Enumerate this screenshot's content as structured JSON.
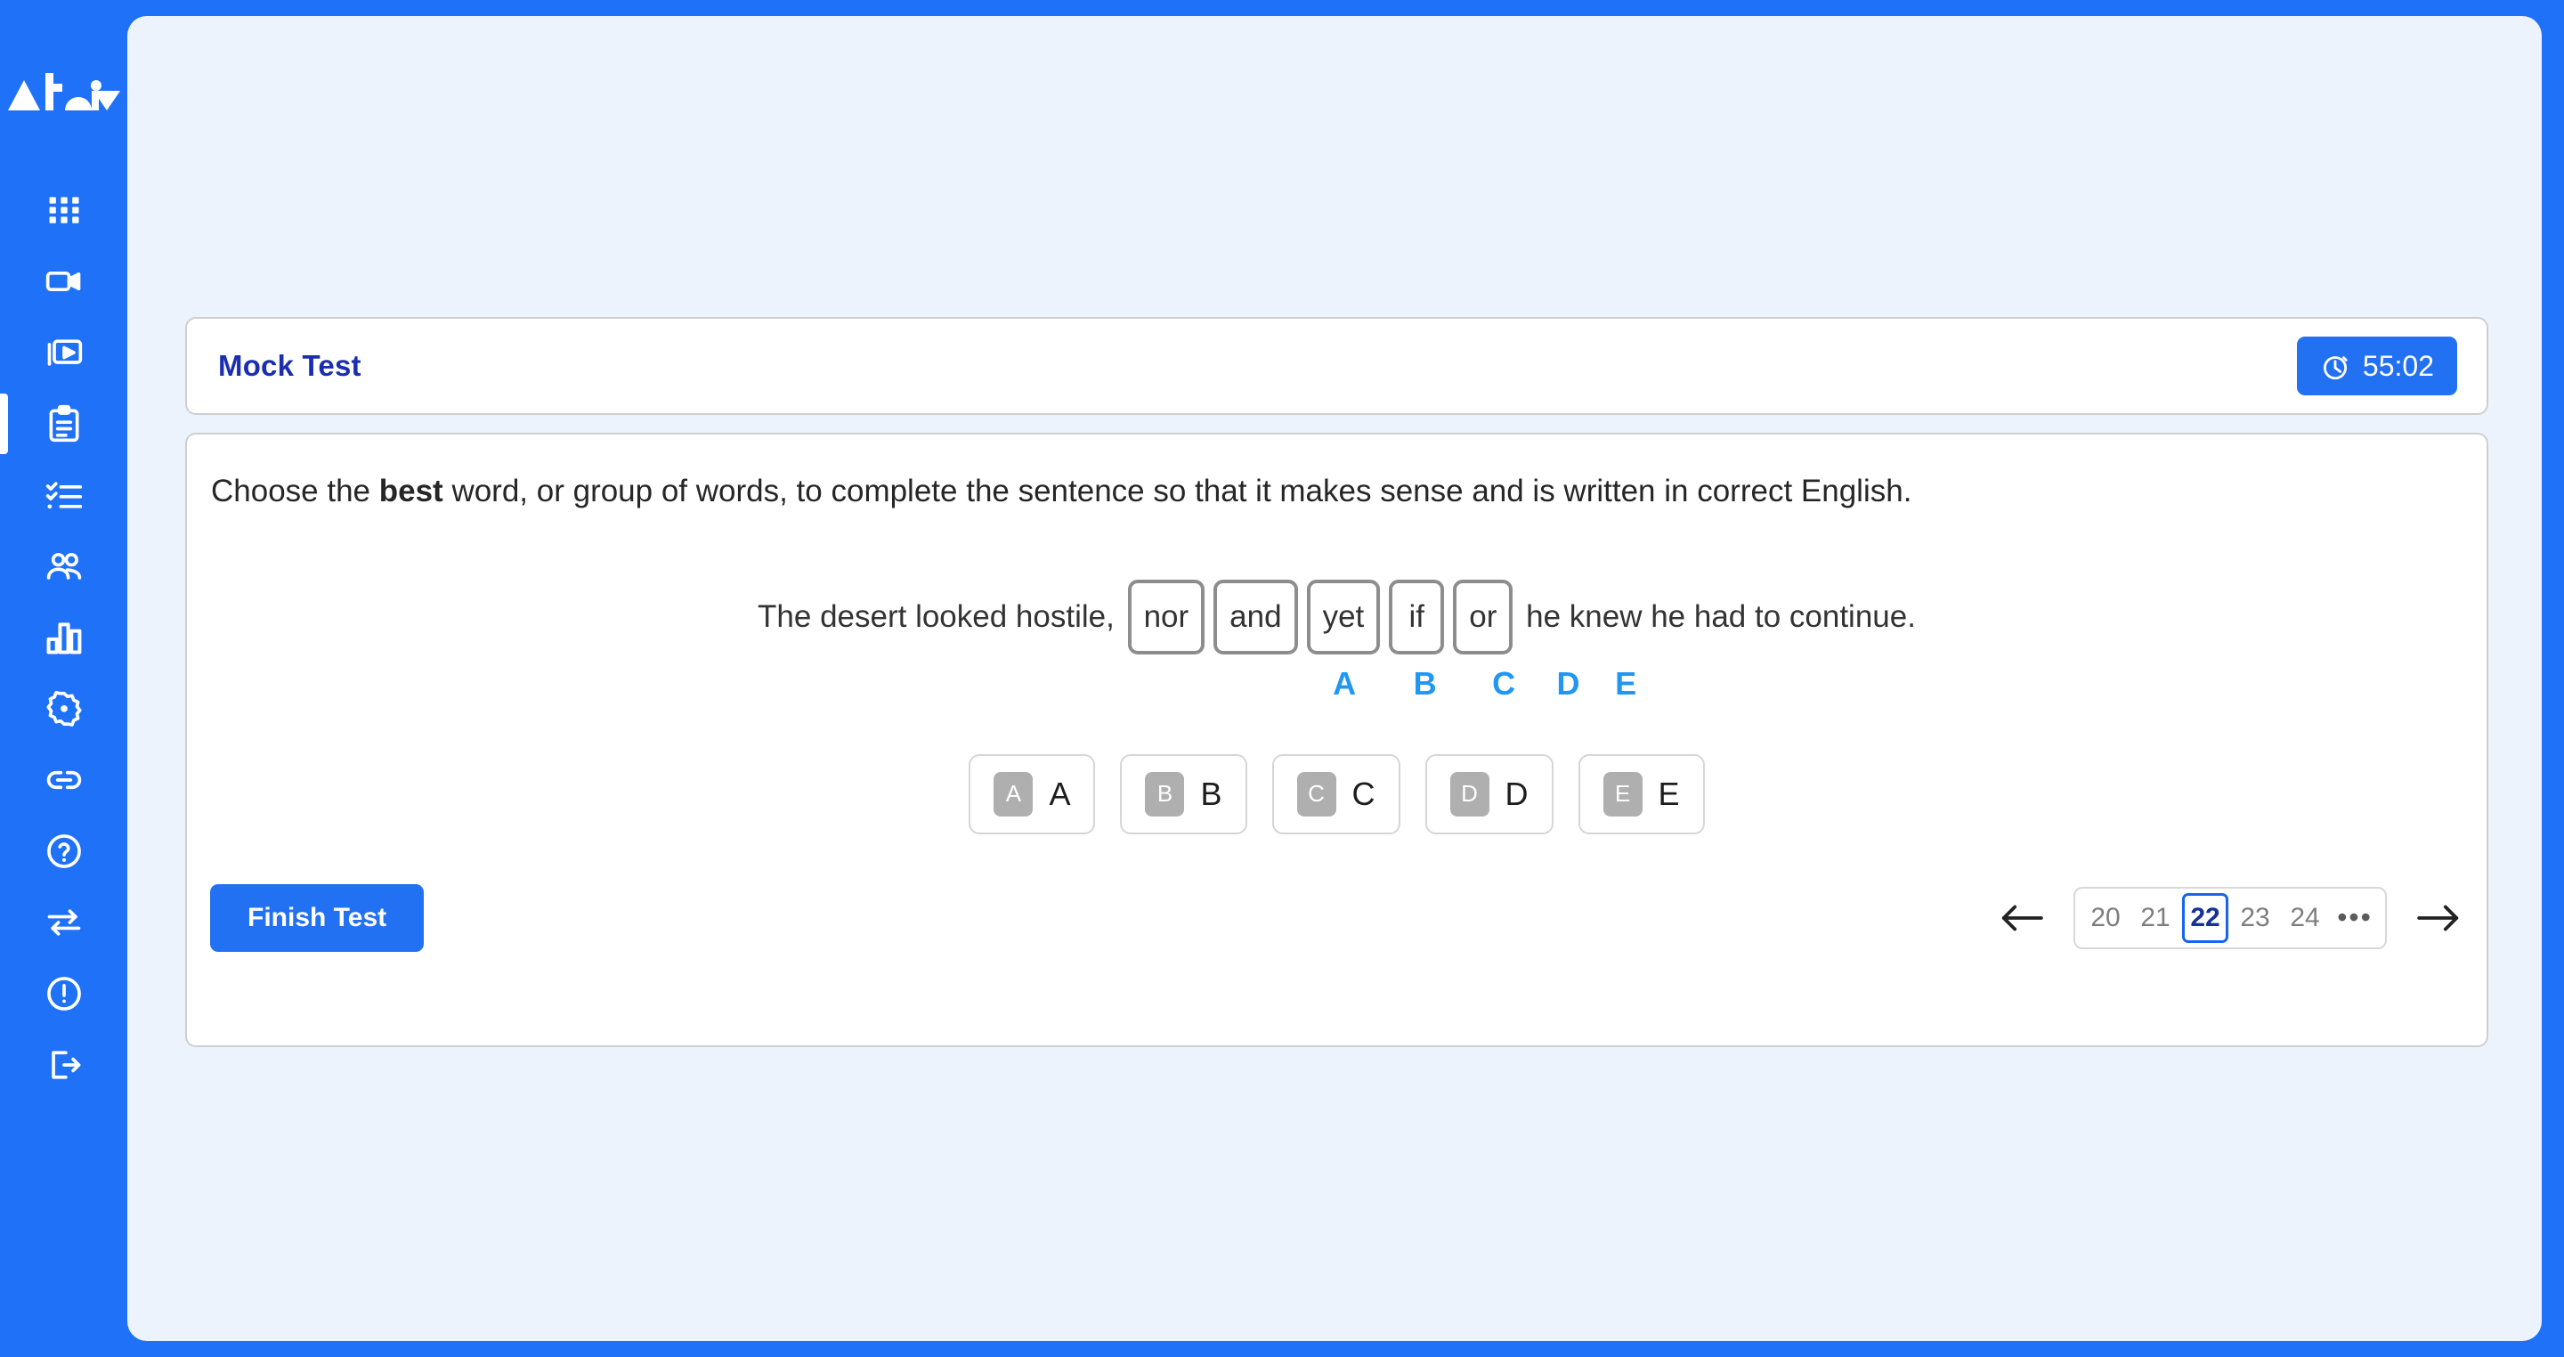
{
  "brand": {
    "logo_text": "ATOM"
  },
  "sidebar": {
    "items": [
      {
        "name": "dashboard",
        "icon": "grid-icon"
      },
      {
        "name": "videos",
        "icon": "video-camera-icon"
      },
      {
        "name": "lessons",
        "icon": "video-library-icon"
      },
      {
        "name": "tests",
        "icon": "clipboard-icon",
        "active": true
      },
      {
        "name": "tasks",
        "icon": "checklist-icon"
      },
      {
        "name": "students",
        "icon": "users-icon"
      },
      {
        "name": "reports",
        "icon": "bar-chart-icon"
      },
      {
        "name": "settings",
        "icon": "gear-icon"
      },
      {
        "name": "links",
        "icon": "link-icon"
      },
      {
        "name": "help",
        "icon": "help-circle-icon"
      },
      {
        "name": "switch",
        "icon": "transfer-arrows-icon"
      },
      {
        "name": "alerts",
        "icon": "alert-circle-icon"
      },
      {
        "name": "logout",
        "icon": "logout-icon"
      }
    ]
  },
  "test": {
    "title": "Mock Test",
    "timer": "55:02",
    "timer_icon": "stopwatch-icon"
  },
  "question": {
    "instruction_pre": "Choose the ",
    "instruction_bold": "best",
    "instruction_post": " word, or group of words, to complete the sentence so that it makes sense and is written in correct English.",
    "sentence_prefix": "The desert looked hostile,",
    "sentence_suffix": "he knew he had to continue.",
    "word_choices": [
      {
        "letter": "A",
        "word": "nor"
      },
      {
        "letter": "B",
        "word": "and"
      },
      {
        "letter": "C",
        "word": "yet"
      },
      {
        "letter": "D",
        "word": "if"
      },
      {
        "letter": "E",
        "word": "or"
      }
    ],
    "options": [
      {
        "badge": "A",
        "label": "A"
      },
      {
        "badge": "B",
        "label": "B"
      },
      {
        "badge": "C",
        "label": "C"
      },
      {
        "badge": "D",
        "label": "D"
      },
      {
        "badge": "E",
        "label": "E"
      }
    ]
  },
  "footer": {
    "finish_label": "Finish Test",
    "prev_icon": "arrow-left-icon",
    "next_icon": "arrow-right-icon",
    "pages": [
      {
        "label": "20",
        "active": false
      },
      {
        "label": "21",
        "active": false
      },
      {
        "label": "22",
        "active": true
      },
      {
        "label": "23",
        "active": false
      },
      {
        "label": "24",
        "active": false
      },
      {
        "label": "•••",
        "active": false,
        "ellipsis": true
      }
    ]
  },
  "colors": {
    "brand_blue": "#1F71F7",
    "panel_bg": "#EDF3FC",
    "accent_blue": "#2171F2",
    "title_blue": "#1A2FB0",
    "letter_blue": "#2196F3",
    "badge_gray": "#AFAFAF"
  }
}
